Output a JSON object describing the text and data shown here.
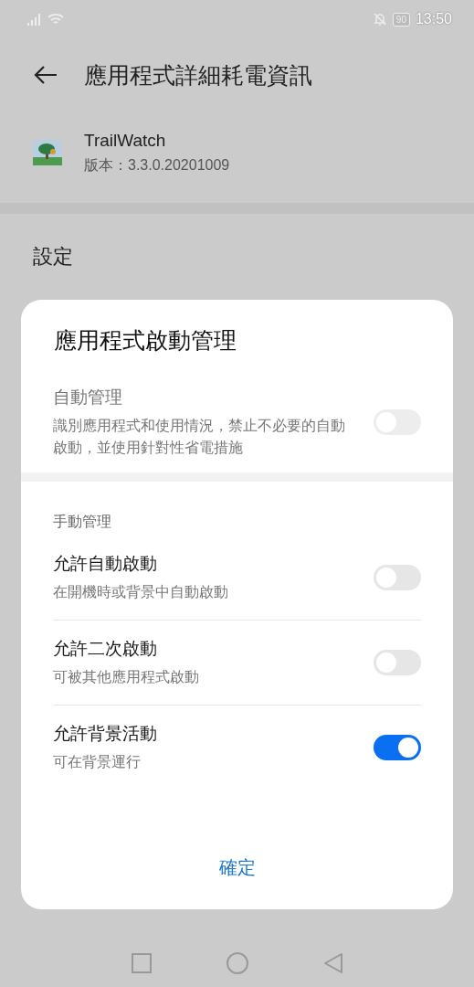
{
  "status_bar": {
    "time": "13:50",
    "battery": "90"
  },
  "header": {
    "title": "應用程式詳細耗電資訊"
  },
  "app": {
    "name": "TrailWatch",
    "version": "版本：3.3.0.20201009"
  },
  "section_title": "設定",
  "dialog": {
    "title": "應用程式啟動管理",
    "auto": {
      "title": "自動管理",
      "description": "識別應用程式和使用情況，禁止不必要的自動啟動，並使用針對性省電措施",
      "on": false,
      "disabled": true
    },
    "manual_header": "手動管理",
    "options": [
      {
        "title": "允許自動啟動",
        "description": "在開機時或背景中自動啟動",
        "on": false
      },
      {
        "title": "允許二次啟動",
        "description": "可被其他應用程式啟動",
        "on": false
      },
      {
        "title": "允許背景活動",
        "description": "可在背景運行",
        "on": true
      }
    ],
    "confirm": "確定"
  }
}
